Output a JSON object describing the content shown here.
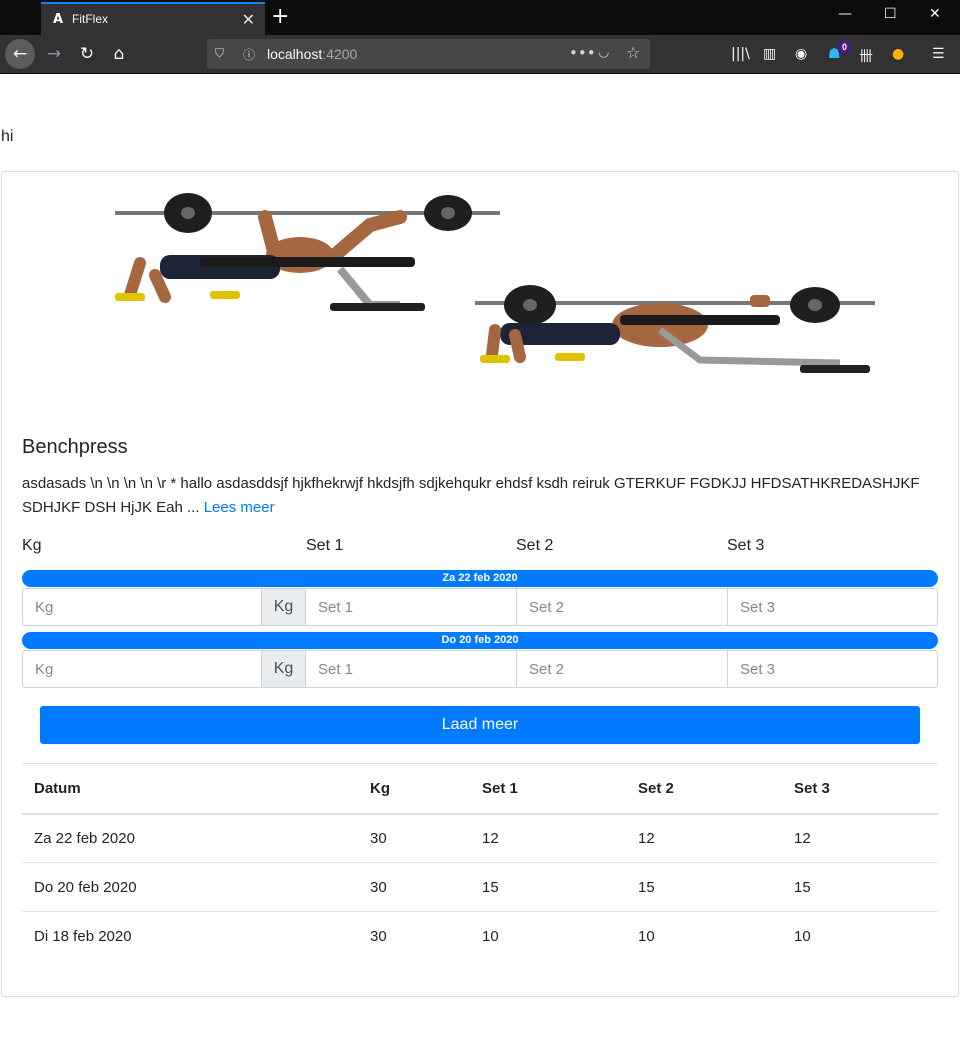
{
  "browser": {
    "tab_title": "FitFlex",
    "favicon": "A",
    "url_host": "localhost",
    "url_port": ":4200",
    "notification_count": "0",
    "icons": [
      "back-arrow-icon",
      "forward-arrow-icon",
      "reload-icon",
      "home-icon",
      "shield-icon",
      "info-icon",
      "more-icon",
      "pocket-icon",
      "star-icon",
      "library-icon",
      "sidebar-icon",
      "account-icon",
      "extension-icon",
      "toolbar-icon",
      "color-icon",
      "menu-icon"
    ]
  },
  "page": {
    "greeting": "hi"
  },
  "exercise": {
    "name": "Benchpress",
    "description": "asdasads \\n \\n \\n \\n \\r * hallo asdasddsjf hjkfhekrwjf hkdsjfh sdjkehqukr ehdsf ksdh reiruk GTERKUF FGDKJJ HFDSATHKREDASHJKF SDHJKF DSH HjJK Eah ...",
    "read_more": "Lees meer",
    "accent_color": "#007bff"
  },
  "form": {
    "headers": {
      "kg": "Kg",
      "set1": "Set 1",
      "set2": "Set 2",
      "set3": "Set 3"
    },
    "entries": [
      {
        "date": "Za 22 feb 2020",
        "kg_placeholder": "Kg",
        "kg_unit": "Kg",
        "set1_placeholder": "Set 1",
        "set2_placeholder": "Set 2",
        "set3_placeholder": "Set 3"
      },
      {
        "date": "Do 20 feb 2020",
        "kg_placeholder": "Kg",
        "kg_unit": "Kg",
        "set1_placeholder": "Set 1",
        "set2_placeholder": "Set 2",
        "set3_placeholder": "Set 3"
      }
    ],
    "load_more": "Laad meer"
  },
  "history": {
    "columns": [
      "Datum",
      "Kg",
      "Set 1",
      "Set 2",
      "Set 3"
    ],
    "rows": [
      [
        "Za 22 feb 2020",
        "30",
        "12",
        "12",
        "12"
      ],
      [
        "Do 20 feb 2020",
        "30",
        "15",
        "15",
        "15"
      ],
      [
        "Di 18 feb 2020",
        "30",
        "10",
        "10",
        "10"
      ]
    ]
  }
}
